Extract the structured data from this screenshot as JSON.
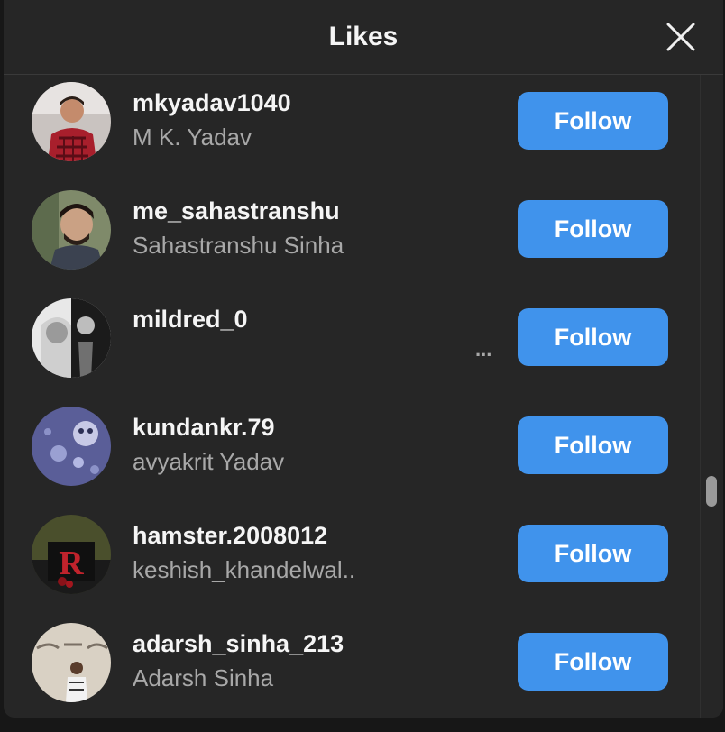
{
  "modal": {
    "title": "Likes",
    "close_icon": "close-icon"
  },
  "colors": {
    "background": "#262626",
    "follow_button": "#4093ec",
    "username_text": "#f5f5f5",
    "fullname_text": "#a8a8a8"
  },
  "users": [
    {
      "username": "mkyadav1040",
      "full_name": "M K. Yadav",
      "button": "Follow"
    },
    {
      "username": "me_sahastranshu",
      "full_name": "Sahastranshu Sinha",
      "button": "Follow"
    },
    {
      "username": "mildred_0",
      "full_name": "",
      "button": "Follow",
      "overflow_text": "..."
    },
    {
      "username": "kundankr.79",
      "full_name": "avyakrit Yadav",
      "button": "Follow"
    },
    {
      "username": "hamster.2008012",
      "full_name": "keshish_khandelwal..",
      "button": "Follow"
    },
    {
      "username": "adarsh_sinha_213",
      "full_name": "Adarsh Sinha",
      "button": "Follow"
    }
  ]
}
